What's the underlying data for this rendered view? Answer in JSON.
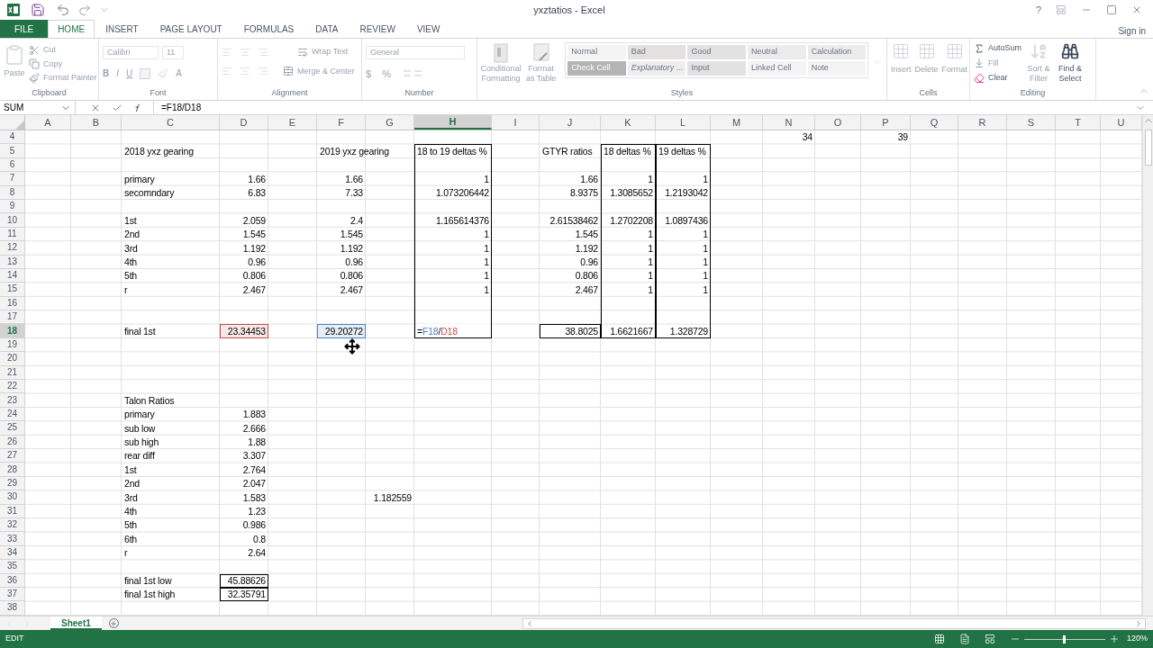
{
  "window": {
    "title": "yxztatios - Excel",
    "help": "?",
    "sign_in": "Sign in",
    "file_button": "FILE"
  },
  "menu_tabs": [
    {
      "label": "HOME",
      "selected": true
    },
    {
      "label": "INSERT",
      "selected": false
    },
    {
      "label": "PAGE LAYOUT",
      "selected": false
    },
    {
      "label": "FORMULAS",
      "selected": false
    },
    {
      "label": "DATA",
      "selected": false
    },
    {
      "label": "REVIEW",
      "selected": false
    },
    {
      "label": "VIEW",
      "selected": false
    }
  ],
  "ribbon": {
    "clipboard": {
      "label": "Clipboard",
      "paste": "Paste",
      "cut": "Cut",
      "copy": "Copy",
      "format_painter": "Format Painter"
    },
    "font": {
      "label": "Font",
      "name": "Calibri",
      "size": "11",
      "bold": "B",
      "italic": "I",
      "underline": "U",
      "font_color": "A"
    },
    "alignment": {
      "label": "Alignment",
      "wrap": "Wrap Text",
      "merge": "Merge & Center"
    },
    "number": {
      "label": "Number",
      "format": "General",
      "currency": "$",
      "percent": "%"
    },
    "styles": {
      "label": "Styles",
      "conditional": "Conditional Formatting",
      "format_table": "Format as Table",
      "gallery": [
        {
          "label": "Normal",
          "color": "#f4f4f4",
          "italic": false
        },
        {
          "label": "Bad",
          "color": "#e4e0e0",
          "italic": false
        },
        {
          "label": "Good",
          "color": "#e2e2e2",
          "italic": false
        },
        {
          "label": "Neutral",
          "color": "#ececec",
          "italic": false
        },
        {
          "label": "Calculation",
          "color": "#ececec",
          "italic": false
        },
        {
          "label": "Check Cell",
          "color": "#b4b4b4",
          "italic": false
        },
        {
          "label": "Explanatory ...",
          "color": "#eeeeee",
          "italic": true
        },
        {
          "label": "Input",
          "color": "#e2e2e2",
          "italic": false
        },
        {
          "label": "Linked Cell",
          "color": "#f4f4f4",
          "italic": false
        },
        {
          "label": "Note",
          "color": "#f4f4f4",
          "italic": false
        }
      ]
    },
    "cells": {
      "label": "Cells",
      "insert": "Insert",
      "delete": "Delete",
      "format": "Format"
    },
    "editing": {
      "label": "Editing",
      "autosum": "AutoSum",
      "fill": "Fill",
      "clear": "Clear",
      "sort": "Sort & Filter",
      "find": "Find & Select"
    }
  },
  "formula_bar": {
    "name_box": "SUM",
    "formula": "=F18/D18"
  },
  "grid": {
    "columns": [
      {
        "label": "A",
        "selected": false
      },
      {
        "label": "B",
        "selected": false
      },
      {
        "label": "C",
        "selected": false
      },
      {
        "label": "D",
        "selected": false
      },
      {
        "label": "E",
        "selected": false
      },
      {
        "label": "F",
        "selected": false
      },
      {
        "label": "G",
        "selected": false
      },
      {
        "label": "H",
        "selected": true
      },
      {
        "label": "I",
        "selected": false
      },
      {
        "label": "J",
        "selected": false
      },
      {
        "label": "K",
        "selected": false
      },
      {
        "label": "L",
        "selected": false
      },
      {
        "label": "M",
        "selected": false
      },
      {
        "label": "N",
        "selected": false
      },
      {
        "label": "O",
        "selected": false
      },
      {
        "label": "P",
        "selected": false
      },
      {
        "label": "Q",
        "selected": false
      },
      {
        "label": "R",
        "selected": false
      },
      {
        "label": "S",
        "selected": false
      },
      {
        "label": "T",
        "selected": false
      },
      {
        "label": "U",
        "selected": false
      }
    ],
    "rows": [
      {
        "number": "4",
        "selected": false,
        "cells": {
          "n": {
            "value": "34",
            "numeric": true
          },
          "p": {
            "value": "39",
            "numeric": true
          }
        }
      },
      {
        "number": "5",
        "selected": false,
        "cells": {
          "c": {
            "value": "2018 yxz gearing"
          },
          "f": {
            "value": "2019 yxz gearing"
          },
          "h": {
            "value": "18 to 19 deltas %",
            "frame_top": true,
            "frame_sides": true
          },
          "j": {
            "value": "GTYR ratios"
          },
          "k": {
            "value": "18 deltas %",
            "frame_top": true,
            "frame_sides": true
          },
          "l": {
            "value": "19 deltas %",
            "frame_top": true,
            "frame_sides": true
          }
        }
      },
      {
        "number": "6",
        "selected": false,
        "cells": {
          "h": {
            "frame_sides": true
          },
          "k": {
            "frame_sides": true
          },
          "l": {
            "frame_sides": true
          }
        }
      },
      {
        "number": "7",
        "selected": false,
        "cells": {
          "c": {
            "value": "primary"
          },
          "d": {
            "value": "1.66",
            "numeric": true
          },
          "f": {
            "value": "1.66",
            "numeric": true
          },
          "h": {
            "value": "1",
            "numeric": true,
            "frame_sides": true
          },
          "j": {
            "value": "1.66",
            "numeric": true
          },
          "k": {
            "value": "1",
            "numeric": true,
            "frame_sides": true
          },
          "l": {
            "value": "1",
            "numeric": true,
            "frame_sides": true
          }
        }
      },
      {
        "number": "8",
        "selected": false,
        "cells": {
          "c": {
            "value": "secomndary"
          },
          "d": {
            "value": "6.83",
            "numeric": true
          },
          "f": {
            "value": "7.33",
            "numeric": true
          },
          "h": {
            "value": "1.073206442",
            "numeric": true,
            "frame_sides": true
          },
          "j": {
            "value": "8.9375",
            "numeric": true
          },
          "k": {
            "value": "1.3085652",
            "numeric": true,
            "frame_sides": true
          },
          "l": {
            "value": "1.2193042",
            "numeric": true,
            "frame_sides": true
          }
        }
      },
      {
        "number": "9",
        "selected": false,
        "cells": {
          "h": {
            "frame_sides": true
          },
          "k": {
            "frame_sides": true
          },
          "l": {
            "frame_sides": true
          }
        }
      },
      {
        "number": "10",
        "selected": false,
        "cells": {
          "c": {
            "value": "1st"
          },
          "d": {
            "value": "2.059",
            "numeric": true
          },
          "f": {
            "value": "2.4",
            "numeric": true
          },
          "h": {
            "value": "1.165614376",
            "numeric": true,
            "frame_sides": true
          },
          "j": {
            "value": "2.61538462",
            "numeric": true
          },
          "k": {
            "value": "1.2702208",
            "numeric": true,
            "frame_sides": true
          },
          "l": {
            "value": "1.0897436",
            "numeric": true,
            "frame_sides": true
          }
        }
      },
      {
        "number": "11",
        "selected": false,
        "cells": {
          "c": {
            "value": "2nd"
          },
          "d": {
            "value": "1.545",
            "numeric": true
          },
          "f": {
            "value": "1.545",
            "numeric": true
          },
          "h": {
            "value": "1",
            "numeric": true,
            "frame_sides": true
          },
          "j": {
            "value": "1.545",
            "numeric": true
          },
          "k": {
            "value": "1",
            "numeric": true,
            "frame_sides": true
          },
          "l": {
            "value": "1",
            "numeric": true,
            "frame_sides": true
          }
        }
      },
      {
        "number": "12",
        "selected": false,
        "cells": {
          "c": {
            "value": "3rd"
          },
          "d": {
            "value": "1.192",
            "numeric": true
          },
          "f": {
            "value": "1.192",
            "numeric": true
          },
          "h": {
            "value": "1",
            "numeric": true,
            "frame_sides": true
          },
          "j": {
            "value": "1.192",
            "numeric": true
          },
          "k": {
            "value": "1",
            "numeric": true,
            "frame_sides": true
          },
          "l": {
            "value": "1",
            "numeric": true,
            "frame_sides": true
          }
        }
      },
      {
        "number": "13",
        "selected": false,
        "cells": {
          "c": {
            "value": "4th"
          },
          "d": {
            "value": "0.96",
            "numeric": true
          },
          "f": {
            "value": "0.96",
            "numeric": true
          },
          "h": {
            "value": "1",
            "numeric": true,
            "frame_sides": true
          },
          "j": {
            "value": "0.96",
            "numeric": true
          },
          "k": {
            "value": "1",
            "numeric": true,
            "frame_sides": true
          },
          "l": {
            "value": "1",
            "numeric": true,
            "frame_sides": true
          }
        }
      },
      {
        "number": "14",
        "selected": false,
        "cells": {
          "c": {
            "value": "5th"
          },
          "d": {
            "value": "0.806",
            "numeric": true
          },
          "f": {
            "value": "0.806",
            "numeric": true
          },
          "h": {
            "value": "1",
            "numeric": true,
            "frame_sides": true
          },
          "j": {
            "value": "0.806",
            "numeric": true
          },
          "k": {
            "value": "1",
            "numeric": true,
            "frame_sides": true
          },
          "l": {
            "value": "1",
            "numeric": true,
            "frame_sides": true
          }
        }
      },
      {
        "number": "15",
        "selected": false,
        "cells": {
          "c": {
            "value": "r"
          },
          "d": {
            "value": "2.467",
            "numeric": true
          },
          "f": {
            "value": "2.467",
            "numeric": true
          },
          "h": {
            "value": "1",
            "numeric": true,
            "frame_sides": true
          },
          "j": {
            "value": "2.467",
            "numeric": true
          },
          "k": {
            "value": "1",
            "numeric": true,
            "frame_sides": true
          },
          "l": {
            "value": "1",
            "numeric": true,
            "frame_sides": true
          }
        }
      },
      {
        "number": "16",
        "selected": false,
        "cells": {
          "h": {
            "frame_sides": true
          },
          "k": {
            "frame_sides": true
          },
          "l": {
            "frame_sides": true
          }
        }
      },
      {
        "number": "17",
        "selected": false,
        "cells": {
          "h": {
            "frame_sides": true
          },
          "k": {
            "frame_sides": true
          },
          "l": {
            "frame_sides": true
          }
        }
      },
      {
        "number": "18",
        "selected": true,
        "cells": {
          "c": {
            "value": "final 1st"
          },
          "d": {
            "value": "23.34453",
            "numeric": true,
            "color": "#c0504d"
          },
          "f": {
            "value": "29.20272",
            "numeric": true,
            "color": "#4f81bd"
          },
          "h": {
            "frame_bottom": true,
            "frame_sides": true,
            "editing": true,
            "parts": [
              {
                "text": "="
              },
              {
                "text": "F18",
                "color": "#4f81bd"
              },
              {
                "text": "/"
              },
              {
                "text": "D18",
                "color": "#c0504d"
              }
            ]
          },
          "j": {
            "value": "38.8025",
            "numeric": true,
            "frame_top": true,
            "frame_bottom": true,
            "frame_sides": true
          },
          "k": {
            "value": "1.6621667",
            "numeric": true,
            "frame_bottom": true,
            "frame_sides": true
          },
          "l": {
            "value": "1.328729",
            "numeric": true,
            "frame_bottom": true,
            "frame_sides": true
          }
        }
      },
      {
        "number": "19",
        "selected": false
      },
      {
        "number": "20",
        "selected": false
      },
      {
        "number": "21",
        "selected": false
      },
      {
        "number": "22",
        "selected": false
      },
      {
        "number": "23",
        "selected": false,
        "cells": {
          "c": {
            "value": "Talon Ratios"
          }
        }
      },
      {
        "number": "24",
        "selected": false,
        "cells": {
          "c": {
            "value": "primary"
          },
          "d": {
            "value": "1.883",
            "numeric": true
          }
        }
      },
      {
        "number": "25",
        "selected": false,
        "cells": {
          "c": {
            "value": "sub low"
          },
          "d": {
            "value": "2.666",
            "numeric": true
          }
        }
      },
      {
        "number": "26",
        "selected": false,
        "cells": {
          "c": {
            "value": "sub high"
          },
          "d": {
            "value": "1.88",
            "numeric": true
          }
        }
      },
      {
        "number": "27",
        "selected": false,
        "cells": {
          "c": {
            "value": "rear diff"
          },
          "d": {
            "value": "3.307",
            "numeric": true
          }
        }
      },
      {
        "number": "28",
        "selected": false,
        "cells": {
          "c": {
            "value": "1st"
          },
          "d": {
            "value": "2.764",
            "numeric": true
          }
        }
      },
      {
        "number": "29",
        "selected": false,
        "cells": {
          "c": {
            "value": "2nd"
          },
          "d": {
            "value": "2.047",
            "numeric": true
          }
        }
      },
      {
        "number": "30",
        "selected": false,
        "cells": {
          "c": {
            "value": "3rd"
          },
          "d": {
            "value": "1.583",
            "numeric": true
          },
          "g": {
            "value": "1.182559",
            "numeric": true
          }
        }
      },
      {
        "number": "31",
        "selected": false,
        "cells": {
          "c": {
            "value": "4th"
          },
          "d": {
            "value": "1.23",
            "numeric": true
          }
        }
      },
      {
        "number": "32",
        "selected": false,
        "cells": {
          "c": {
            "value": "5th"
          },
          "d": {
            "value": "0.986",
            "numeric": true
          }
        }
      },
      {
        "number": "33",
        "selected": false,
        "cells": {
          "c": {
            "value": "6th"
          },
          "d": {
            "value": "0.8",
            "numeric": true
          }
        }
      },
      {
        "number": "34",
        "selected": false,
        "cells": {
          "c": {
            "value": "r"
          },
          "d": {
            "value": "2.64",
            "numeric": true
          }
        }
      },
      {
        "number": "35",
        "selected": false
      },
      {
        "number": "36",
        "selected": false,
        "cells": {
          "c": {
            "value": "final 1st low"
          },
          "d": {
            "value": "45.88626",
            "numeric": true,
            "frame_top": true,
            "frame_bottom": true,
            "frame_sides": true
          }
        }
      },
      {
        "number": "37",
        "selected": false,
        "cells": {
          "c": {
            "value": "final 1st high"
          },
          "d": {
            "value": "32.35791",
            "numeric": true,
            "frame_top": true,
            "frame_bottom": true,
            "frame_sides": true
          }
        }
      },
      {
        "number": "38",
        "selected": false
      }
    ]
  },
  "sheet_tabs": [
    {
      "label": "Sheet1",
      "selected": true
    }
  ],
  "status_bar": {
    "mode": "EDIT",
    "zoom": "120%",
    "zoom_slider": {
      "level": 0.5
    }
  }
}
